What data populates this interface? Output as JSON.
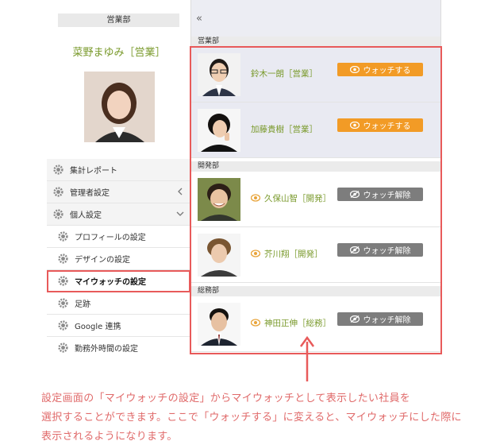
{
  "sidebar": {
    "department": "営業部",
    "user_name": "菜野まゆみ［営業］",
    "menu": [
      {
        "label": "集計レポート",
        "chevron": ""
      },
      {
        "label": "管理者設定",
        "chevron": "left"
      },
      {
        "label": "個人設定",
        "chevron": "down"
      },
      {
        "label": "プロフィールの設定",
        "chevron": ""
      },
      {
        "label": "デザインの設定",
        "chevron": ""
      },
      {
        "label": "マイウォッチの設定",
        "chevron": ""
      },
      {
        "label": "足跡",
        "chevron": ""
      },
      {
        "label": "Google 連携",
        "chevron": ""
      },
      {
        "label": "勤務外時間の設定",
        "chevron": ""
      }
    ]
  },
  "panel": {
    "collapse_icon": "«",
    "groups": [
      {
        "name": "営業部",
        "members": [
          {
            "name": "鈴木一朗［営業］",
            "button": "ウォッチする",
            "state": "on"
          },
          {
            "name": "加藤貴樹［営業］",
            "button": "ウォッチする",
            "state": "on"
          }
        ]
      },
      {
        "name": "開発部",
        "members": [
          {
            "name": "久保山智［開発］",
            "button": "ウォッチ解除",
            "state": "off"
          },
          {
            "name": "芥川翔［開発］",
            "button": "ウォッチ解除",
            "state": "off"
          }
        ]
      },
      {
        "name": "総務部",
        "members": [
          {
            "name": "神田正伸［総務］",
            "button": "ウォッチ解除",
            "state": "off"
          }
        ]
      }
    ]
  },
  "caption": {
    "line1": "設定画面の「マイウォッチの設定」からマイウォッチとして表示したい社員を",
    "line2": "選択することができます。ここで「ウォッチする」に変えると、マイウォッチにした際に",
    "line3": "表示されるようになります。"
  },
  "colors": {
    "accent_red": "#e85a5a",
    "watch_on": "#f29b26",
    "watch_off": "#7d7d7d",
    "name_green": "#7a9a2c"
  }
}
